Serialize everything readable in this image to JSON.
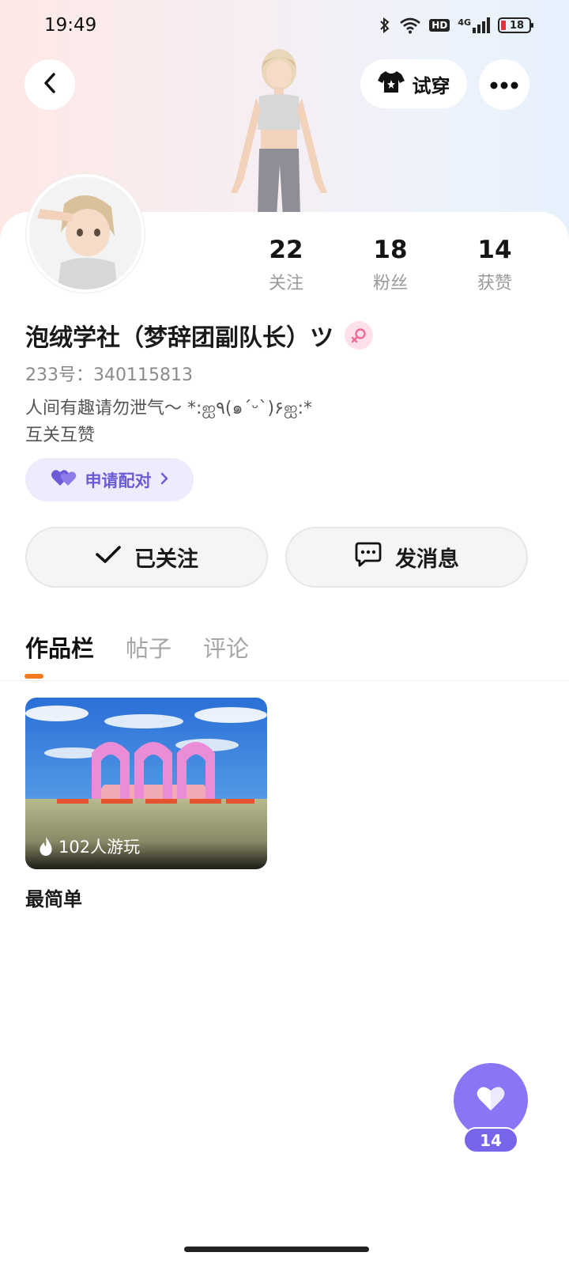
{
  "status_bar": {
    "time": "19:49",
    "network": "4G",
    "hd": "HD",
    "battery": "18"
  },
  "header": {
    "tryon_label": "试穿"
  },
  "stats": [
    {
      "value": "22",
      "label": "关注"
    },
    {
      "value": "18",
      "label": "粉丝"
    },
    {
      "value": "14",
      "label": "获赞"
    }
  ],
  "profile": {
    "nickname": "泡绒学社（梦辞团副队长）ツ",
    "uid": "233号：340115813",
    "bio_line1": "人间有趣请勿泄气～ *:ஐ٩(๑´ᵕ`)۶ஐ:*",
    "bio_line2": "互关互赞",
    "pair_label": "申请配对"
  },
  "actions": {
    "follow_label": "已关注",
    "message_label": "发消息"
  },
  "tabs": [
    {
      "label": "作品栏",
      "active": true
    },
    {
      "label": "帖子",
      "active": false
    },
    {
      "label": "评论",
      "active": false
    }
  ],
  "works": [
    {
      "title": "最简单",
      "plays": "102人游玩"
    }
  ],
  "like_fab": {
    "count": "14"
  },
  "colors": {
    "accent_purple": "#8a76f5",
    "tab_indicator": "#f37a1f",
    "pair_text": "#6b5bd6"
  }
}
